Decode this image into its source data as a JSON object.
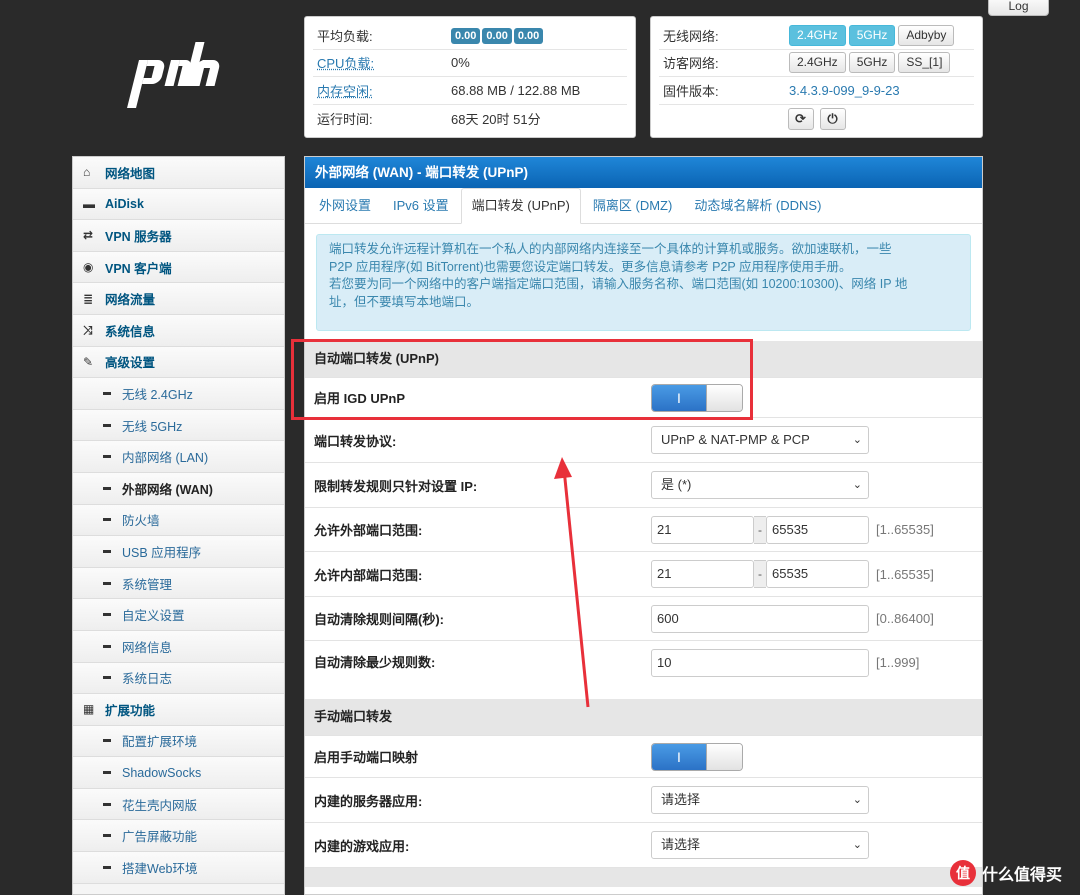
{
  "header": {
    "logout_label": "Log"
  },
  "sysinfo": {
    "load_label": "平均负载:",
    "load_values": [
      "0.00",
      "0.00",
      "0.00"
    ],
    "cpu_label": "CPU负载:",
    "cpu_value": "0%",
    "mem_label": "内存空闲:",
    "mem_value": "68.88 MB / 122.88 MB",
    "uptime_label": "运行时间:",
    "uptime_value": "68天 20时 51分"
  },
  "wireless": {
    "wifi_label": "无线网络:",
    "wifi_buttons": [
      "2.4GHz",
      "5GHz",
      "Adbyby"
    ],
    "guest_label": "访客网络:",
    "guest_buttons": [
      "2.4GHz",
      "5GHz",
      "SS_[1]"
    ],
    "firmware_label": "固件版本:",
    "firmware_value": "3.4.3.9-099_9-9-23"
  },
  "sidebar": {
    "items": [
      {
        "label": "网络地图",
        "icon": "home-icon",
        "glyph": "⌂"
      },
      {
        "label": "AiDisk",
        "icon": "drive-icon",
        "glyph": "▬"
      },
      {
        "label": "VPN 服务器",
        "icon": "retweet-icon",
        "glyph": "⇄"
      },
      {
        "label": "VPN 客户端",
        "icon": "globe-icon",
        "glyph": "◉"
      },
      {
        "label": "网络流量",
        "icon": "list-icon",
        "glyph": "≣"
      },
      {
        "label": "系统信息",
        "icon": "shuffle-icon",
        "glyph": "⤨"
      },
      {
        "label": "高级设置",
        "icon": "wrench-icon",
        "glyph": "✎"
      }
    ],
    "sub_items": [
      "无线 2.4GHz",
      "无线 5GHz",
      "内部网络 (LAN)",
      "外部网络 (WAN)",
      "防火墙",
      "USB 应用程序",
      "系统管理",
      "自定义设置",
      "网络信息",
      "系统日志"
    ],
    "ext_label": "扩展功能",
    "ext_icon": "grid-icon",
    "ext_items": [
      "配置扩展环境",
      "ShadowSocks",
      "花生壳内网版",
      "广告屏蔽功能",
      "搭建Web环境"
    ]
  },
  "panel": {
    "title": "外部网络 (WAN) - 端口转发 (UPnP)",
    "tabs": [
      "外网设置",
      "IPv6 设置",
      "端口转发 (UPnP)",
      "隔离区 (DMZ)",
      "动态域名解析 (DDNS)"
    ],
    "alert_lines": [
      "端口转发允许远程计算机在一个私人的内部网络内连接至一个具体的计算机或服务。欲加速联机，一些",
      "P2P 应用程序(如 BitTorrent)也需要您设定端口转发。更多信息请参考 P2P 应用程序使用手册。",
      "若您要为同一个网络中的客户端指定端口范围，请输入服务名称、端口范围(如 10200:10300)、网络 IP 地",
      "址，但不要填写本地端口。"
    ],
    "auto_section": "自动端口转发 (UPnP)",
    "igd_label": "启用 IGD UPnP",
    "toggle_on": "I",
    "proto_label": "端口转发协议:",
    "proto_value": "UPnP & NAT-PMP & PCP",
    "restrict_label": "限制转发规则只针对设置 IP:",
    "restrict_value": "是 (*)",
    "ext_range_label": "允许外部端口范围:",
    "ext_range_from": "21",
    "ext_range_to": "65535",
    "ext_range_hint": "[1..65535]",
    "int_range_label": "允许内部端口范围:",
    "int_range_from": "21",
    "int_range_to": "65535",
    "int_range_hint": "[1..65535]",
    "clean_interval_label": "自动清除规则间隔(秒):",
    "clean_interval_value": "600",
    "clean_interval_hint": "[0..86400]",
    "clean_min_label": "自动清除最少规则数:",
    "clean_min_value": "10",
    "clean_min_hint": "[1..999]",
    "manual_section": "手动端口转发",
    "manual_enable_label": "启用手动端口映射",
    "builtin_server_label": "内建的服务器应用:",
    "builtin_server_value": "请选择",
    "builtin_game_label": "内建的游戏应用:",
    "builtin_game_value": "请选择",
    "range_sep": "-"
  },
  "watermark": {
    "text": "什么值得买",
    "icon_glyph": "值"
  },
  "colors": {
    "header_blue": "#0b64b3",
    "annotation_red": "#e8303a",
    "badge_blue": "#3a87ad"
  }
}
